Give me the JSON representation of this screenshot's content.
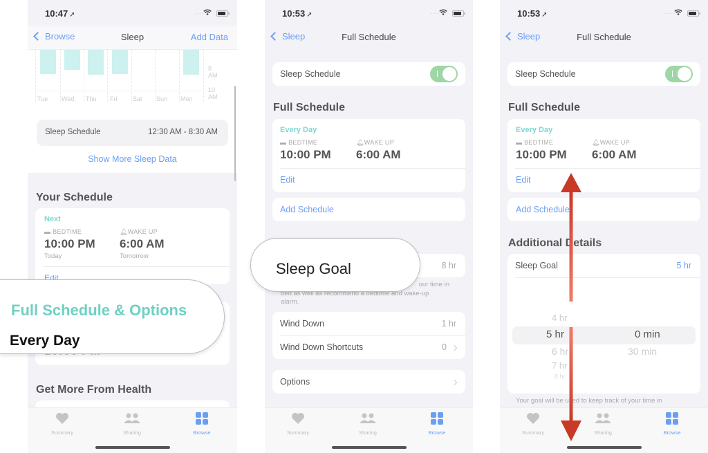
{
  "panels": [
    {
      "status": {
        "time": "10:47",
        "signal": "....",
        "loc_icon": "location-arrow-icon"
      },
      "nav": {
        "back": "Browse",
        "title": "Sleep",
        "right": "Add Data"
      },
      "chart": {
        "days": [
          "Tue",
          "Wed",
          "Thu",
          "Fri",
          "Sat",
          "Sun",
          "Mon"
        ],
        "axis_labels": [
          "8 AM",
          "10 AM"
        ]
      },
      "schedule_row": {
        "label": "Sleep Schedule",
        "value": "12:30 AM - 8:30 AM"
      },
      "show_more": "Show More Sleep Data",
      "your_schedule": {
        "heading": "Your Schedule",
        "next_label": "Next",
        "bedtime_label": "BEDTIME",
        "bedtime": "10:00 PM",
        "bedtime_sub": "Today",
        "wake_label": "WAKE UP",
        "wake": "6:00 AM",
        "wake_sub": "Tomorrow",
        "edit": "Edit"
      },
      "callout": {
        "title": "Full Schedule & Options",
        "subtitle": "Every Day"
      },
      "get_more": "Get More From Health"
    },
    {
      "status": {
        "time": "10:53",
        "signal": "...."
      },
      "nav": {
        "back": "Sleep",
        "title": "Full Schedule"
      },
      "toggle_row": {
        "label": "Sleep Schedule",
        "on": true
      },
      "full_schedule": {
        "heading": "Full Schedule",
        "days": "Every Day",
        "bedtime_label": "BEDTIME",
        "bedtime": "10:00 PM",
        "wake_label": "WAKE UP",
        "wake": "6:00 AM",
        "edit": "Edit",
        "add": "Add Schedule"
      },
      "callout": {
        "title": "Sleep Goal"
      },
      "sleep_goal_value": "8 hr",
      "goal_note_1": "our time in",
      "goal_note_2": "bed as well as recommend a bedtime and wake-up",
      "goal_note_3": "alarm.",
      "wind_down": {
        "label": "Wind Down",
        "value": "1 hr"
      },
      "wind_shortcuts": {
        "label": "Wind Down Shortcuts",
        "value": "0"
      },
      "options": {
        "label": "Options"
      }
    },
    {
      "status": {
        "time": "10:53",
        "signal": "...."
      },
      "nav": {
        "back": "Sleep",
        "title": "Full Schedule"
      },
      "toggle_row": {
        "label": "Sleep Schedule",
        "on": true
      },
      "full_schedule": {
        "heading": "Full Schedule",
        "days": "Every Day",
        "bedtime_label": "BEDTIME",
        "bedtime": "10:00 PM",
        "wake_label": "WAKE UP",
        "wake": "6:00 AM",
        "edit": "Edit",
        "add": "Add Schedule"
      },
      "additional": {
        "heading": "Additional Details",
        "sleep_goal_label": "Sleep Goal",
        "sleep_goal_value": "5 hr"
      },
      "picker": {
        "hours": [
          "4 hr",
          "5 hr",
          "6 hr",
          "7 hr",
          "8 hr"
        ],
        "selected_hour": "5 hr",
        "minutes": [
          "0 min",
          "30 min"
        ],
        "selected_minute": "0 min"
      },
      "goal_note": "Your goal will be used to keep track of your time in"
    }
  ],
  "tabbar": {
    "tabs": [
      {
        "label": "Summary",
        "icon": "heart-icon",
        "active": false
      },
      {
        "label": "Sharing",
        "icon": "people-icon",
        "active": false
      },
      {
        "label": "Browse",
        "icon": "grid-icon",
        "active": true
      }
    ]
  },
  "colors": {
    "accent_blue": "#6b9ff5",
    "teal": "#7fd8d2",
    "toggle_green": "#9ed6a5",
    "arrow_red": "#d9412b"
  }
}
